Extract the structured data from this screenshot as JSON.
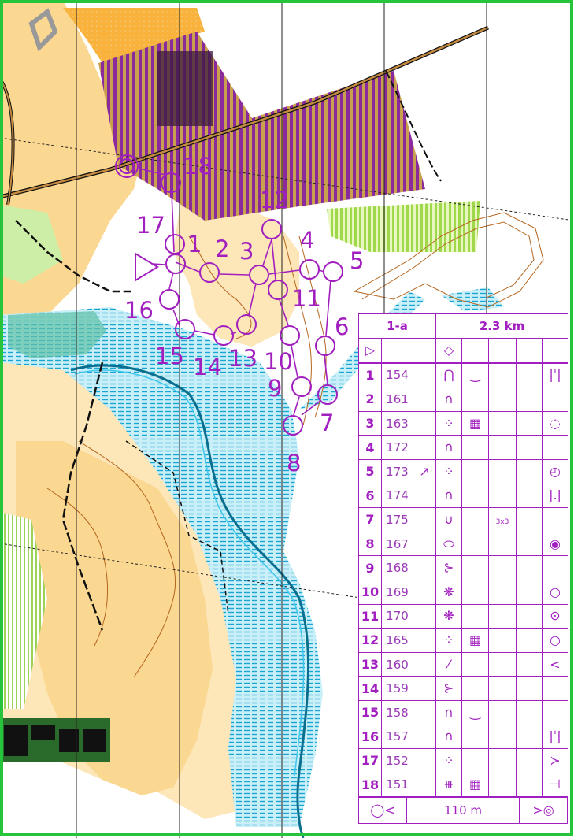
{
  "course": {
    "name": "1-a",
    "length": "2.3 km",
    "finish_distance": "110 m",
    "control_numbers": [
      "18",
      "12",
      "17",
      "1",
      "2",
      "3",
      "4",
      "5",
      "16",
      "11",
      "6",
      "15",
      "14",
      "13",
      "10",
      "9",
      "7",
      "8"
    ]
  },
  "controls": [
    {
      "num": "1",
      "code": "154",
      "c": "",
      "d": "bump",
      "e": "shallow-depression",
      "f": "",
      "g": "",
      "h": "side-left"
    },
    {
      "num": "2",
      "code": "161",
      "c": "",
      "d": "knoll",
      "e": "",
      "f": "",
      "g": "",
      "h": ""
    },
    {
      "num": "3",
      "code": "163",
      "c": "",
      "d": "dotted-circle",
      "e": "grid",
      "f": "",
      "g": "",
      "h": "partly-circle"
    },
    {
      "num": "4",
      "code": "172",
      "c": "",
      "d": "knoll",
      "e": "",
      "f": "",
      "g": "",
      "h": ""
    },
    {
      "num": "5",
      "code": "173",
      "c": "arrow-ne",
      "d": "dotted-circle",
      "e": "",
      "f": "",
      "g": "",
      "h": "circle-dot"
    },
    {
      "num": "6",
      "code": "174",
      "c": "",
      "d": "knoll",
      "e": "",
      "f": "",
      "g": "",
      "h": "side-left-dot"
    },
    {
      "num": "7",
      "code": "175",
      "c": "",
      "d": "cup",
      "e": "",
      "f": "3x3",
      "g": "",
      "h": ""
    },
    {
      "num": "8",
      "code": "167",
      "c": "",
      "d": "ellipse",
      "e": "",
      "f": "",
      "g": "",
      "h": "filled-dot-circle"
    },
    {
      "num": "9",
      "code": "168",
      "c": "",
      "d": "reentrant",
      "e": "",
      "f": "",
      "g": "",
      "h": ""
    },
    {
      "num": "10",
      "code": "169",
      "c": "",
      "d": "thicket",
      "e": "",
      "f": "",
      "g": "",
      "h": "circle-small"
    },
    {
      "num": "11",
      "code": "170",
      "c": "",
      "d": "thicket",
      "e": "",
      "f": "",
      "g": "",
      "h": "circle-dot-center"
    },
    {
      "num": "12",
      "code": "165",
      "c": "",
      "d": "dotted-circle",
      "e": "grid",
      "f": "",
      "g": "",
      "h": "circle-small"
    },
    {
      "num": "13",
      "code": "160",
      "c": "",
      "d": "slash-line",
      "e": "",
      "f": "",
      "g": "",
      "h": "less-than"
    },
    {
      "num": "14",
      "code": "159",
      "c": "",
      "d": "reentrant",
      "e": "",
      "f": "",
      "g": "",
      "h": ""
    },
    {
      "num": "15",
      "code": "158",
      "c": "",
      "d": "knoll",
      "e": "shallow-depression",
      "f": "",
      "g": "",
      "h": ""
    },
    {
      "num": "16",
      "code": "157",
      "c": "",
      "d": "knoll",
      "e": "",
      "f": "",
      "g": "",
      "h": "side-left"
    },
    {
      "num": "17",
      "code": "152",
      "c": "",
      "d": "dotted-circle",
      "e": "",
      "f": "",
      "g": "",
      "h": "y-fork"
    },
    {
      "num": "18",
      "code": "151",
      "c": "",
      "d": "fence-line",
      "e": "grid",
      "f": "",
      "g": "",
      "h": "tee-right"
    }
  ],
  "colors": {
    "course": "#a21fbf",
    "open_land": "#fbd892",
    "rough_open": "#fde6b8",
    "water": "#34b8e0",
    "marsh": "#3fb6d6",
    "vegetation": "#7ed957",
    "cultivated": "#7a3d8a",
    "border": "#26c43a",
    "contour": "#b5651d",
    "black": "#111111"
  },
  "icons": {
    "start": "start-triangle-icon",
    "control": "control-circle-icon",
    "finish": "finish-double-circle-icon"
  }
}
